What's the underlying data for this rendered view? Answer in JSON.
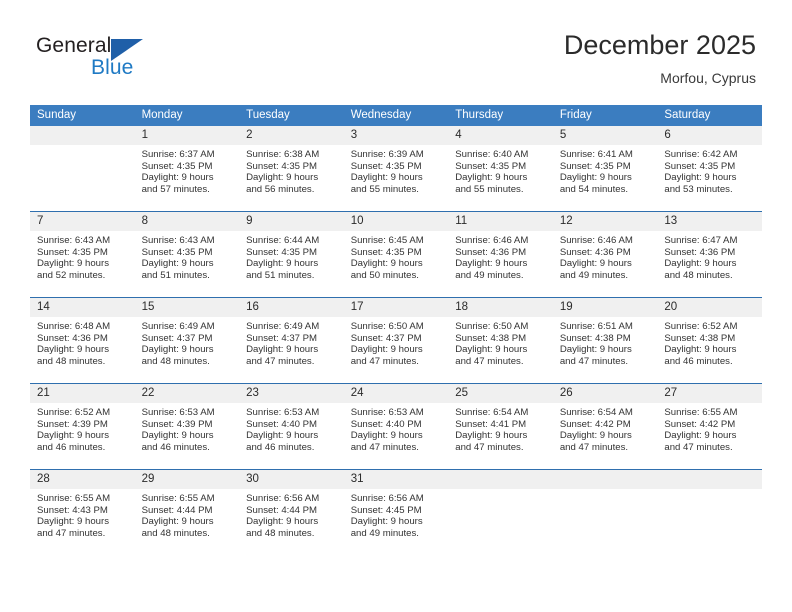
{
  "brand": {
    "name_top": "General",
    "name_bottom": "Blue",
    "flag_icon": "triangle-flag-icon",
    "accent_color": "#1f7ac4",
    "flag_color": "#1f5fa8"
  },
  "header": {
    "month_title": "December 2025",
    "location": "Morfou, Cyprus"
  },
  "calendar": {
    "header_color": "#3b7dc0",
    "daynum_band_color": "#f0f0f0",
    "row_divider_color": "#2f6fae",
    "weekday_headers": [
      "Sunday",
      "Monday",
      "Tuesday",
      "Wednesday",
      "Thursday",
      "Friday",
      "Saturday"
    ],
    "weeks": [
      [
        {
          "day": "",
          "empty": true,
          "sunrise": "",
          "sunset": "",
          "daylight_1": "",
          "daylight_2": ""
        },
        {
          "day": "1",
          "sunrise": "Sunrise: 6:37 AM",
          "sunset": "Sunset: 4:35 PM",
          "daylight_1": "Daylight: 9 hours",
          "daylight_2": "and 57 minutes."
        },
        {
          "day": "2",
          "sunrise": "Sunrise: 6:38 AM",
          "sunset": "Sunset: 4:35 PM",
          "daylight_1": "Daylight: 9 hours",
          "daylight_2": "and 56 minutes."
        },
        {
          "day": "3",
          "sunrise": "Sunrise: 6:39 AM",
          "sunset": "Sunset: 4:35 PM",
          "daylight_1": "Daylight: 9 hours",
          "daylight_2": "and 55 minutes."
        },
        {
          "day": "4",
          "sunrise": "Sunrise: 6:40 AM",
          "sunset": "Sunset: 4:35 PM",
          "daylight_1": "Daylight: 9 hours",
          "daylight_2": "and 55 minutes."
        },
        {
          "day": "5",
          "sunrise": "Sunrise: 6:41 AM",
          "sunset": "Sunset: 4:35 PM",
          "daylight_1": "Daylight: 9 hours",
          "daylight_2": "and 54 minutes."
        },
        {
          "day": "6",
          "sunrise": "Sunrise: 6:42 AM",
          "sunset": "Sunset: 4:35 PM",
          "daylight_1": "Daylight: 9 hours",
          "daylight_2": "and 53 minutes."
        }
      ],
      [
        {
          "day": "7",
          "sunrise": "Sunrise: 6:43 AM",
          "sunset": "Sunset: 4:35 PM",
          "daylight_1": "Daylight: 9 hours",
          "daylight_2": "and 52 minutes."
        },
        {
          "day": "8",
          "sunrise": "Sunrise: 6:43 AM",
          "sunset": "Sunset: 4:35 PM",
          "daylight_1": "Daylight: 9 hours",
          "daylight_2": "and 51 minutes."
        },
        {
          "day": "9",
          "sunrise": "Sunrise: 6:44 AM",
          "sunset": "Sunset: 4:35 PM",
          "daylight_1": "Daylight: 9 hours",
          "daylight_2": "and 51 minutes."
        },
        {
          "day": "10",
          "sunrise": "Sunrise: 6:45 AM",
          "sunset": "Sunset: 4:35 PM",
          "daylight_1": "Daylight: 9 hours",
          "daylight_2": "and 50 minutes."
        },
        {
          "day": "11",
          "sunrise": "Sunrise: 6:46 AM",
          "sunset": "Sunset: 4:36 PM",
          "daylight_1": "Daylight: 9 hours",
          "daylight_2": "and 49 minutes."
        },
        {
          "day": "12",
          "sunrise": "Sunrise: 6:46 AM",
          "sunset": "Sunset: 4:36 PM",
          "daylight_1": "Daylight: 9 hours",
          "daylight_2": "and 49 minutes."
        },
        {
          "day": "13",
          "sunrise": "Sunrise: 6:47 AM",
          "sunset": "Sunset: 4:36 PM",
          "daylight_1": "Daylight: 9 hours",
          "daylight_2": "and 48 minutes."
        }
      ],
      [
        {
          "day": "14",
          "sunrise": "Sunrise: 6:48 AM",
          "sunset": "Sunset: 4:36 PM",
          "daylight_1": "Daylight: 9 hours",
          "daylight_2": "and 48 minutes."
        },
        {
          "day": "15",
          "sunrise": "Sunrise: 6:49 AM",
          "sunset": "Sunset: 4:37 PM",
          "daylight_1": "Daylight: 9 hours",
          "daylight_2": "and 48 minutes."
        },
        {
          "day": "16",
          "sunrise": "Sunrise: 6:49 AM",
          "sunset": "Sunset: 4:37 PM",
          "daylight_1": "Daylight: 9 hours",
          "daylight_2": "and 47 minutes."
        },
        {
          "day": "17",
          "sunrise": "Sunrise: 6:50 AM",
          "sunset": "Sunset: 4:37 PM",
          "daylight_1": "Daylight: 9 hours",
          "daylight_2": "and 47 minutes."
        },
        {
          "day": "18",
          "sunrise": "Sunrise: 6:50 AM",
          "sunset": "Sunset: 4:38 PM",
          "daylight_1": "Daylight: 9 hours",
          "daylight_2": "and 47 minutes."
        },
        {
          "day": "19",
          "sunrise": "Sunrise: 6:51 AM",
          "sunset": "Sunset: 4:38 PM",
          "daylight_1": "Daylight: 9 hours",
          "daylight_2": "and 47 minutes."
        },
        {
          "day": "20",
          "sunrise": "Sunrise: 6:52 AM",
          "sunset": "Sunset: 4:38 PM",
          "daylight_1": "Daylight: 9 hours",
          "daylight_2": "and 46 minutes."
        }
      ],
      [
        {
          "day": "21",
          "sunrise": "Sunrise: 6:52 AM",
          "sunset": "Sunset: 4:39 PM",
          "daylight_1": "Daylight: 9 hours",
          "daylight_2": "and 46 minutes."
        },
        {
          "day": "22",
          "sunrise": "Sunrise: 6:53 AM",
          "sunset": "Sunset: 4:39 PM",
          "daylight_1": "Daylight: 9 hours",
          "daylight_2": "and 46 minutes."
        },
        {
          "day": "23",
          "sunrise": "Sunrise: 6:53 AM",
          "sunset": "Sunset: 4:40 PM",
          "daylight_1": "Daylight: 9 hours",
          "daylight_2": "and 46 minutes."
        },
        {
          "day": "24",
          "sunrise": "Sunrise: 6:53 AM",
          "sunset": "Sunset: 4:40 PM",
          "daylight_1": "Daylight: 9 hours",
          "daylight_2": "and 47 minutes."
        },
        {
          "day": "25",
          "sunrise": "Sunrise: 6:54 AM",
          "sunset": "Sunset: 4:41 PM",
          "daylight_1": "Daylight: 9 hours",
          "daylight_2": "and 47 minutes."
        },
        {
          "day": "26",
          "sunrise": "Sunrise: 6:54 AM",
          "sunset": "Sunset: 4:42 PM",
          "daylight_1": "Daylight: 9 hours",
          "daylight_2": "and 47 minutes."
        },
        {
          "day": "27",
          "sunrise": "Sunrise: 6:55 AM",
          "sunset": "Sunset: 4:42 PM",
          "daylight_1": "Daylight: 9 hours",
          "daylight_2": "and 47 minutes."
        }
      ],
      [
        {
          "day": "28",
          "sunrise": "Sunrise: 6:55 AM",
          "sunset": "Sunset: 4:43 PM",
          "daylight_1": "Daylight: 9 hours",
          "daylight_2": "and 47 minutes."
        },
        {
          "day": "29",
          "sunrise": "Sunrise: 6:55 AM",
          "sunset": "Sunset: 4:44 PM",
          "daylight_1": "Daylight: 9 hours",
          "daylight_2": "and 48 minutes."
        },
        {
          "day": "30",
          "sunrise": "Sunrise: 6:56 AM",
          "sunset": "Sunset: 4:44 PM",
          "daylight_1": "Daylight: 9 hours",
          "daylight_2": "and 48 minutes."
        },
        {
          "day": "31",
          "sunrise": "Sunrise: 6:56 AM",
          "sunset": "Sunset: 4:45 PM",
          "daylight_1": "Daylight: 9 hours",
          "daylight_2": "and 49 minutes."
        },
        {
          "day": "",
          "empty": true,
          "sunrise": "",
          "sunset": "",
          "daylight_1": "",
          "daylight_2": ""
        },
        {
          "day": "",
          "empty": true,
          "sunrise": "",
          "sunset": "",
          "daylight_1": "",
          "daylight_2": ""
        },
        {
          "day": "",
          "empty": true,
          "sunrise": "",
          "sunset": "",
          "daylight_1": "",
          "daylight_2": ""
        }
      ]
    ]
  }
}
